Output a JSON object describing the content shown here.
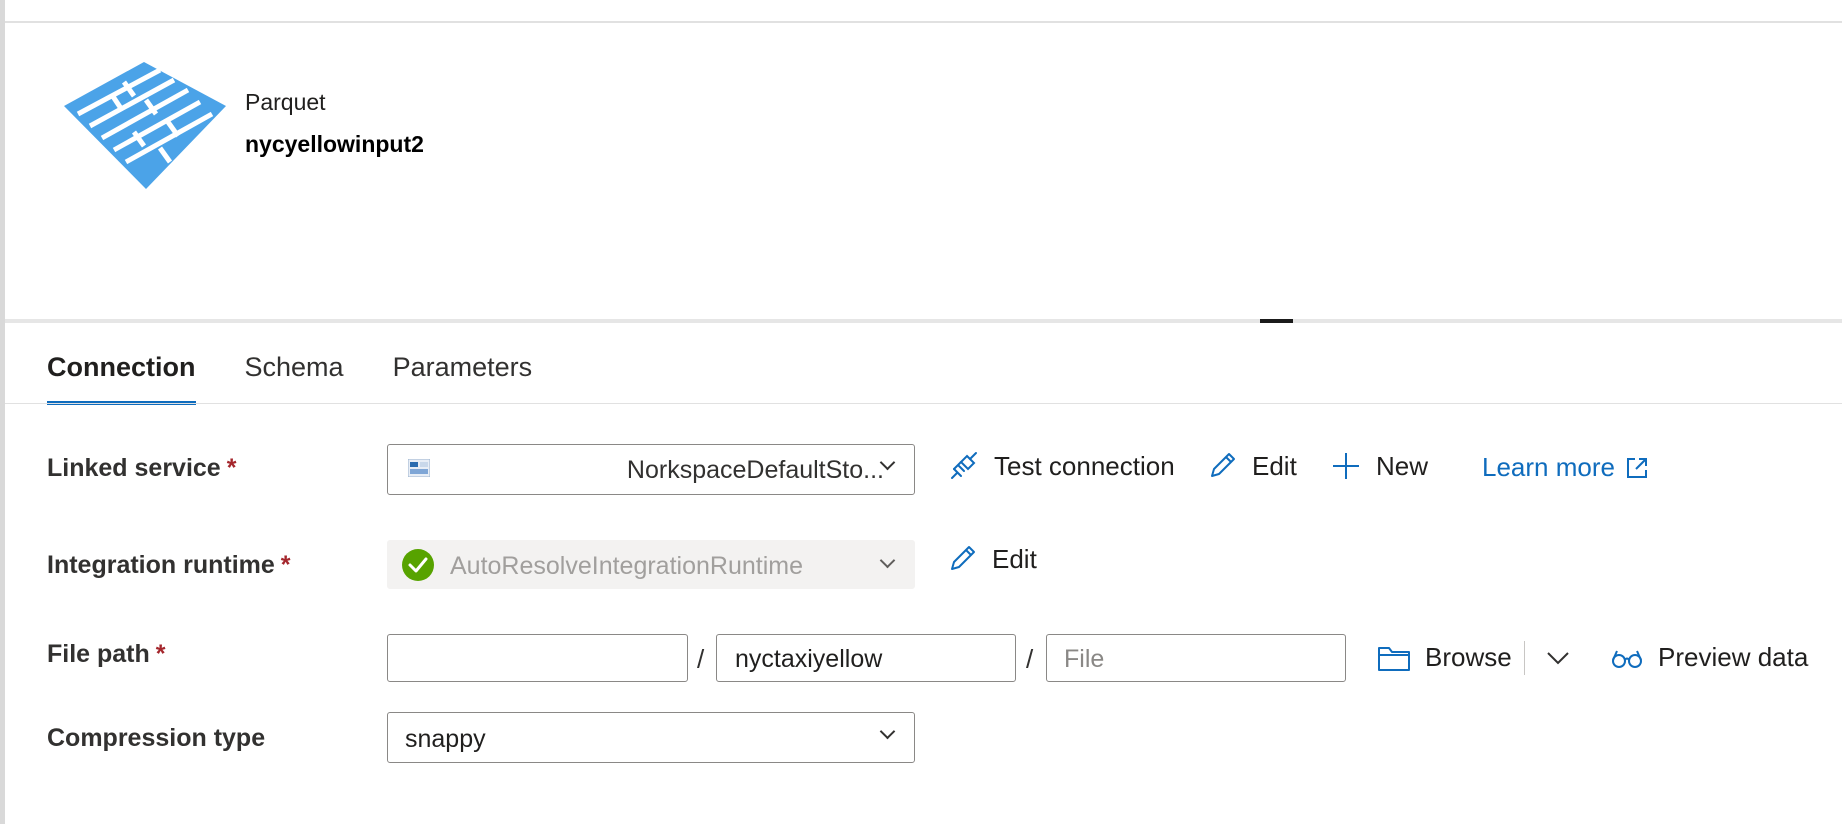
{
  "dataset": {
    "type": "Parquet",
    "name": "nycyellowinput2"
  },
  "tabs": [
    {
      "label": "Connection",
      "active": true
    },
    {
      "label": "Schema",
      "active": false
    },
    {
      "label": "Parameters",
      "active": false
    }
  ],
  "form": {
    "required_marker": "*",
    "linked_service": {
      "label": "Linked service",
      "value": "NorkspaceDefaultSto..."
    },
    "integration_runtime": {
      "label": "Integration runtime",
      "value": "AutoResolveIntegrationRuntime"
    },
    "file_path": {
      "label": "File path",
      "container": "",
      "directory": "nyctaxiyellow",
      "file_placeholder": "File",
      "separator": "/"
    },
    "compression_type": {
      "label": "Compression type",
      "value": "snappy"
    }
  },
  "actions": {
    "test_connection": "Test connection",
    "edit": "Edit",
    "new": "New",
    "learn_more": "Learn more",
    "runtime_edit": "Edit",
    "browse": "Browse",
    "preview_data": "Preview data"
  },
  "colors": {
    "accent": "#0f6cbd",
    "logo": "#4ba3e8",
    "status_ok": "#57a300",
    "required": "#a4262c"
  },
  "icons": [
    "parquet-logo",
    "storage-icon",
    "plug-icon",
    "pencil-icon",
    "plus-icon",
    "external-link-icon",
    "check-circle-icon",
    "folder-icon",
    "chevron-down-icon",
    "glasses-icon"
  ]
}
